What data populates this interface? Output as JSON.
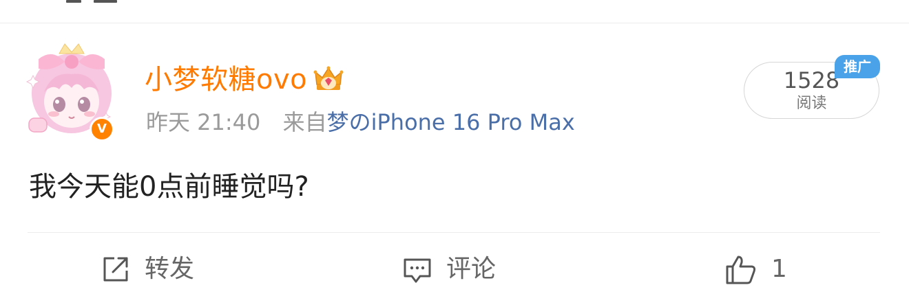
{
  "post": {
    "author": {
      "name": "小梦软糖ovo",
      "verified_mark": "V",
      "avatar_icon": "anime-girl-avatar",
      "badge_icon": "crown-icon"
    },
    "meta": {
      "time": "昨天 21:40",
      "source_prefix": "来自",
      "source_name": "梦のiPhone 16 Pro Max"
    },
    "read_stats": {
      "count": "1528",
      "label": "阅读",
      "promo_tag": "推广"
    },
    "content": "我今天能0点前睡觉吗?",
    "actions": {
      "repost_label": "转发",
      "comment_label": "评论",
      "like_count": "1"
    }
  },
  "colors": {
    "username": "#ff7a00",
    "source_link": "#4a6ea8",
    "promo_tag": "#4aa3e8",
    "verified": "#ff8200"
  }
}
